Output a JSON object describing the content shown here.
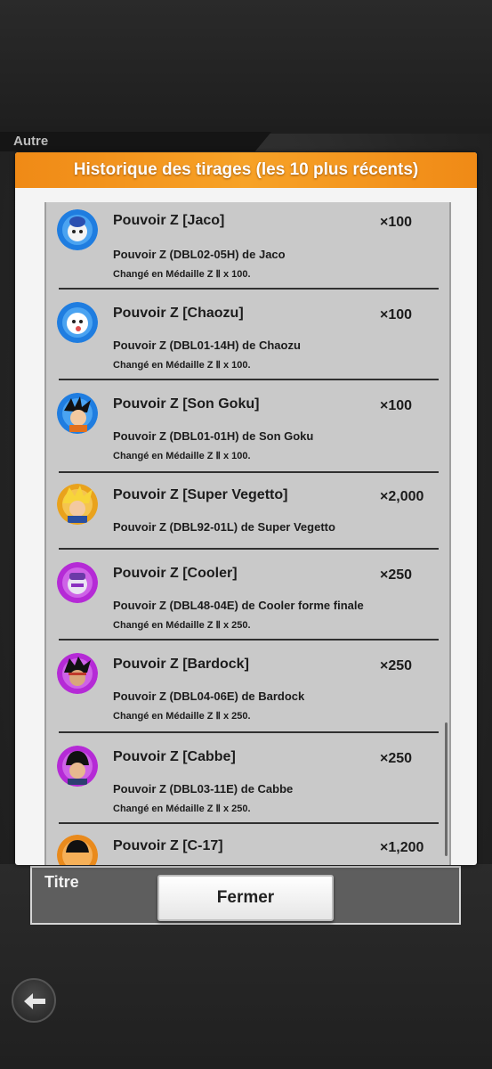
{
  "section_label": "Autre",
  "dialog": {
    "title": "Historique des tirages (les 10 plus récents)",
    "items": [
      {
        "title": "Pouvoir Z [Jaco]",
        "qty": "×100",
        "desc": "Pouvoir Z (DBL02-05H) de Jaco",
        "note": "Changé en Médaille Z Ⅱ x 100.",
        "aura": "#1f7de0"
      },
      {
        "title": "Pouvoir Z [Chaozu]",
        "qty": "×100",
        "desc": "Pouvoir Z (DBL01-14H) de Chaozu",
        "note": "Changé en Médaille Z Ⅱ x 100.",
        "aura": "#1f7de0"
      },
      {
        "title": "Pouvoir Z [Son Goku]",
        "qty": "×100",
        "desc": "Pouvoir Z (DBL01-01H) de Son Goku",
        "note": "Changé en Médaille Z Ⅱ x 100.",
        "aura": "#1f7de0"
      },
      {
        "title": "Pouvoir Z [Super Vegetto]",
        "qty": "×2,000",
        "desc": "Pouvoir Z (DBL92-01L) de Super Vegetto",
        "note": "",
        "aura": "#e9a21c"
      },
      {
        "title": "Pouvoir Z [Cooler]",
        "qty": "×250",
        "desc": "Pouvoir Z (DBL48-04E) de Cooler forme finale",
        "note": "Changé en Médaille Z Ⅱ x 250.",
        "aura": "#b52ad6"
      },
      {
        "title": "Pouvoir Z [Bardock]",
        "qty": "×250",
        "desc": "Pouvoir Z (DBL04-06E) de Bardock",
        "note": "Changé en Médaille Z Ⅱ x 250.",
        "aura": "#b52ad6"
      },
      {
        "title": "Pouvoir Z [Cabbe]",
        "qty": "×250",
        "desc": "Pouvoir Z (DBL03-11E) de Cabbe",
        "note": "Changé en Médaille Z Ⅱ x 250.",
        "aura": "#b52ad6"
      },
      {
        "title": "Pouvoir Z [C-17]",
        "qty": "×1,200",
        "desc": "",
        "note": "",
        "aura": "#e98a1c"
      }
    ]
  },
  "titre_label": "Titre",
  "close_label": "Fermer",
  "icons": {
    "back": "back-arrow-icon"
  }
}
